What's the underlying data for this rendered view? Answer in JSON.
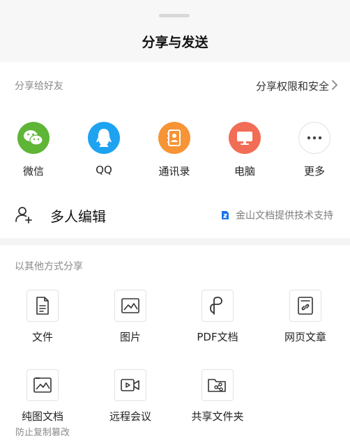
{
  "header": {
    "title": "分享与发送"
  },
  "share_friends": {
    "label": "分享给好友",
    "permission_link": "分享权限和安全",
    "targets": [
      {
        "label": "微信",
        "icon": "wechat-icon",
        "color": "#5fb536"
      },
      {
        "label": "QQ",
        "icon": "qq-icon",
        "color": "#1ea3f1"
      },
      {
        "label": "通讯录",
        "icon": "contacts-icon",
        "color": "#f79436"
      },
      {
        "label": "电脑",
        "icon": "computer-icon",
        "color": "#f26d55"
      },
      {
        "label": "更多",
        "icon": "more-icon",
        "color": "#ffffff"
      }
    ]
  },
  "collab": {
    "label": "多人编辑",
    "powered_by": "金山文档提供技术支持",
    "powered_color": "#1a73e8"
  },
  "other_share": {
    "label": "以其他方式分享",
    "items": [
      {
        "label": "文件",
        "icon": "file-icon"
      },
      {
        "label": "图片",
        "icon": "image-icon"
      },
      {
        "label": "PDF文档",
        "icon": "pdf-icon"
      },
      {
        "label": "网页文章",
        "icon": "webpage-icon"
      },
      {
        "label": "纯图文档",
        "icon": "image-doc-icon",
        "sub": "防止复制篡改"
      },
      {
        "label": "远程会议",
        "icon": "meeting-icon"
      },
      {
        "label": "共享文件夹",
        "icon": "shared-folder-icon"
      }
    ]
  }
}
